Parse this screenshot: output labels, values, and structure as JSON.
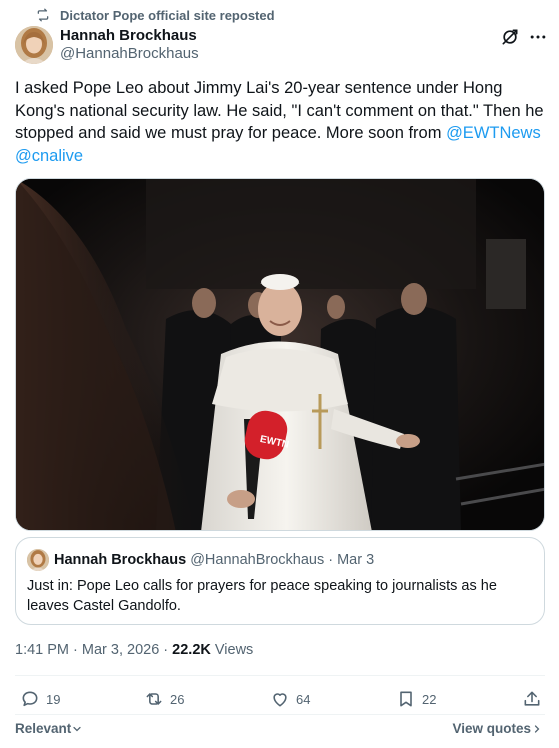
{
  "repost": {
    "label": "Dictator Pope official site reposted",
    "icon": "repost-icon"
  },
  "author": {
    "name": "Hannah Brockhaus",
    "handle": "@HannahBrockhaus"
  },
  "tweet": {
    "text_part1": "I asked Pope Leo about Jimmy Lai's 20-year sentence under Hong Kong's national security law. He said, \"I can't comment on that.\" Then he stopped and said we must pray for peace. More soon from ",
    "mention1": "@EWTNews",
    "mention2": "@cnalive"
  },
  "photo": {
    "microphone_label": "EWTN"
  },
  "quote": {
    "name": "Hannah Brockhaus",
    "meta": "@HannahBrockhaus · Mar 3",
    "text": "Just in: Pope Leo calls for prayers for peace speaking to journalists as he leaves Castel Gandolfo."
  },
  "meta": {
    "time_date": "1:41 PM · Mar 3, 2026 · ",
    "views_count": "22.2K",
    "views_label": " Views"
  },
  "actions": {
    "replies": "19",
    "reposts": "26",
    "likes": "64",
    "bookmarks": "22"
  },
  "footer": {
    "sort_label": "Relevant",
    "view_quotes_label": "View quotes"
  },
  "colors": {
    "link": "#1d9bf0",
    "secondary_text": "#536471",
    "border": "#cfd9de"
  }
}
